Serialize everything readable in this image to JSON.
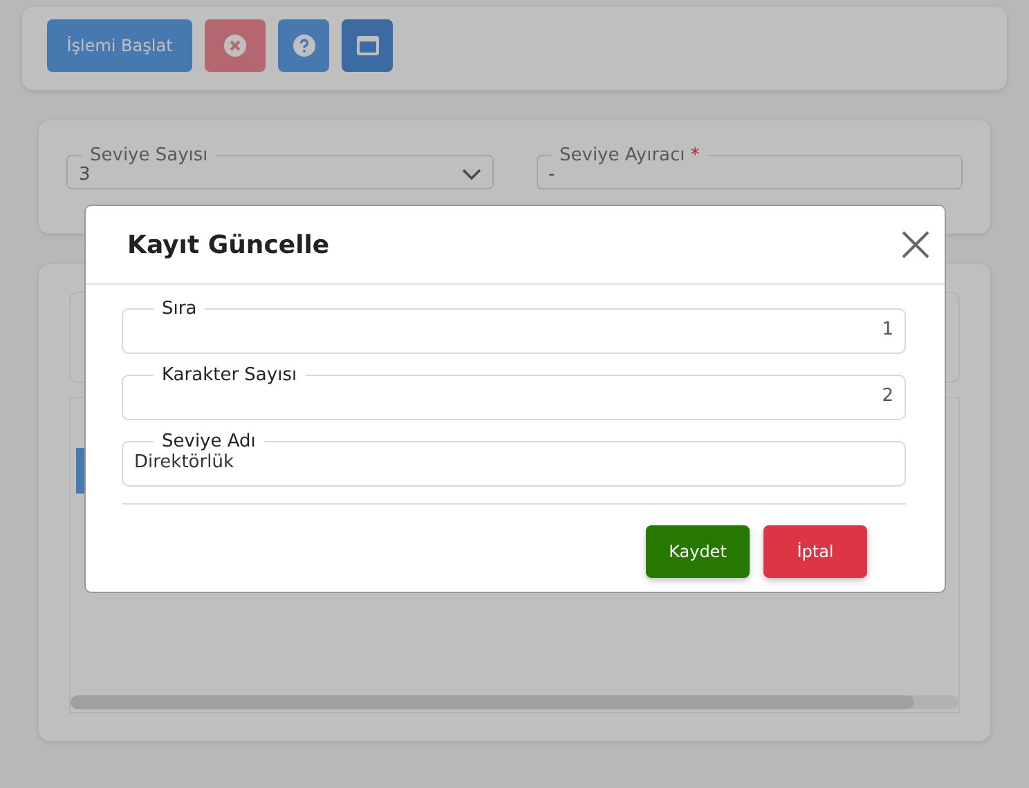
{
  "toolbar": [
    {
      "kind": "start",
      "label": "İşlemi Başlat"
    },
    {
      "kind": "cancel"
    },
    {
      "kind": "help"
    },
    {
      "kind": "window"
    }
  ],
  "filters": [
    {
      "kind": "select",
      "label": "Seviye Sayısı",
      "value": "3"
    },
    {
      "kind": "text",
      "label": "Seviye Ayıracı",
      "value": "-",
      "required_mark": "*"
    }
  ],
  "modal": {
    "title": "Kayıt Güncelle",
    "fields": [
      {
        "kind": "number",
        "label": "Sıra",
        "value": "1"
      },
      {
        "kind": "number",
        "label": "Karakter Sayısı",
        "value": "2"
      },
      {
        "kind": "text",
        "label": "Seviye Adı",
        "value": "Direktörlük"
      }
    ],
    "buttons": [
      {
        "kind": "save",
        "label": "Kaydet"
      },
      {
        "kind": "cancel",
        "label": "İptal"
      }
    ]
  }
}
